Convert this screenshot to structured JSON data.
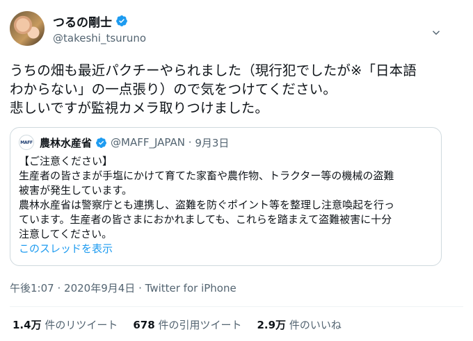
{
  "author": {
    "name": "つるの剛士",
    "handle": "@takeshi_tsuruno",
    "verified_color": "#1d9bf0"
  },
  "tweet": {
    "text": "うちの畑も最近パクチーやられました（現行犯でしたが※「日本語\nわからない」の一点張り）ので気をつけてください。\n悲しいですが監視カメラ取りつけました。"
  },
  "quote": {
    "logo_text": "MAFF",
    "name": "農林水産省",
    "handle": "@MAFF_JAPAN",
    "date": "9月3日",
    "separator": "·",
    "text": "【ご注意ください】\n生産者の皆さまが手塩にかけて育てた家畜や農作物、トラクター等の機械の盗難\n被害が発生しています。\n農林水産省は警察庁とも連携し、盗難を防ぐポイント等を整理し注意喚起を行っ\nています。生産者の皆さまにおかれましても、これらを踏まえて盗難被害に十分\n注意してください。",
    "show_thread": "このスレッドを表示"
  },
  "meta": {
    "time": "午後1:07",
    "date": "2020年9月4日",
    "separator": "·",
    "source": "Twitter for iPhone"
  },
  "stats": [
    {
      "count": "1.4万",
      "label": "件のリツイート"
    },
    {
      "count": "678",
      "label": "件の引用ツイート"
    },
    {
      "count": "2.9万",
      "label": "件のいいね"
    }
  ],
  "colors": {
    "accent": "#1d9bf0",
    "text": "#0f1419",
    "secondary": "#536471",
    "border": "#cfd9de"
  },
  "icons": {
    "verified": "verified-badge-icon",
    "caret": "chevron-down-icon"
  }
}
